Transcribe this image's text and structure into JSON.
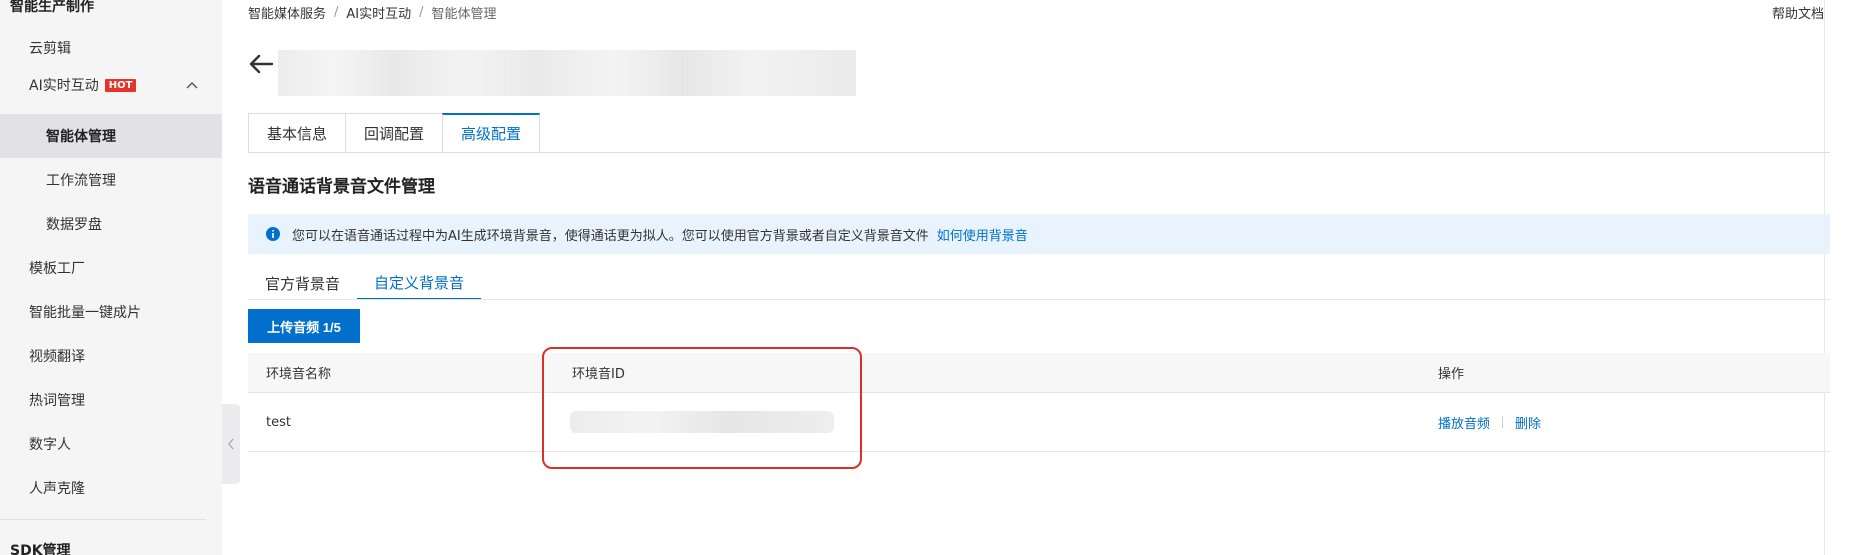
{
  "sidebar": {
    "group_top": "智能生产制作",
    "items": [
      {
        "label": "云剪辑"
      },
      {
        "label": "AI实时互动",
        "badge": "HOT"
      },
      {
        "label": "智能体管理"
      },
      {
        "label": "工作流管理"
      },
      {
        "label": "数据罗盘"
      },
      {
        "label": "模板工厂"
      },
      {
        "label": "智能批量一键成片"
      },
      {
        "label": "视频翻译"
      },
      {
        "label": "热词管理"
      },
      {
        "label": "数字人"
      },
      {
        "label": "人声克隆"
      }
    ],
    "group_bottom": "SDK管理"
  },
  "breadcrumb": [
    "智能媒体服务",
    "AI实时互动",
    "智能体管理"
  ],
  "help_label": "帮助文档",
  "tabs": [
    "基本信息",
    "回调配置",
    "高级配置"
  ],
  "active_tab": "高级配置",
  "section_title": "语音通话背景音文件管理",
  "alert": {
    "text": "您可以在语音通话过程中为AI生成环境背景音，使得通话更为拟人。您可以使用官方背景或者自定义背景音文件",
    "link": "如何使用背景音"
  },
  "subtabs": [
    "官方背景音",
    "自定义背景音"
  ],
  "active_subtab": "自定义背景音",
  "upload_label": "上传音频 1/5",
  "table": {
    "columns": [
      "环境音名称",
      "环境音ID",
      "操作"
    ],
    "rows": [
      {
        "name": "test",
        "actions": [
          "播放音频",
          "删除"
        ]
      }
    ]
  },
  "colors": {
    "accent": "#0070cc",
    "hot_badge": "#e5342c",
    "highlight": "#d9302a",
    "alert_bg": "#e8f3fd"
  }
}
